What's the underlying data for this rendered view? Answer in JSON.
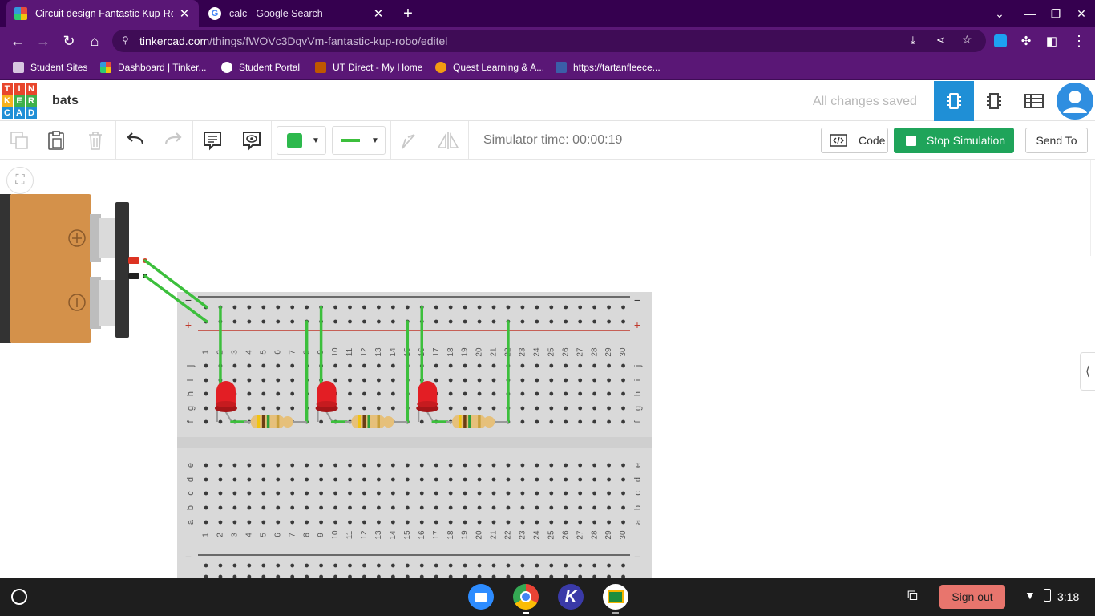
{
  "browser": {
    "tabs": [
      {
        "title": "Circuit design Fantastic Kup-Robo",
        "active": true
      },
      {
        "title": "calc - Google Search",
        "active": false
      }
    ],
    "url_host": "tinkercad.com",
    "url_path": "/things/fWOVc3DqvVm-fantastic-kup-robo/editel",
    "bookmarks": [
      "Student Sites",
      "Dashboard | Tinker...",
      "Student Portal",
      "UT Direct - My Home",
      "Quest Learning & A...",
      "https://tartanfleece..."
    ]
  },
  "header": {
    "logo_letters": [
      "T",
      "I",
      "N",
      "K",
      "E",
      "R",
      "C",
      "A",
      "D"
    ],
    "design_name": "bats",
    "save_status": "All changes saved"
  },
  "toolbar": {
    "simulator_time": "Simulator time: 00:00:19",
    "code_label": "Code",
    "stop_label": "Stop Simulation",
    "send_to_label": "Send To",
    "shape_color": "#2db94d"
  },
  "breadboard": {
    "column_numbers": [
      "1",
      "2",
      "3",
      "4",
      "5",
      "6",
      "7",
      "8",
      "9",
      "10",
      "11",
      "12",
      "13",
      "14",
      "15",
      "16",
      "17",
      "18",
      "19",
      "20",
      "21",
      "22",
      "23",
      "24",
      "25",
      "26",
      "27",
      "28",
      "29",
      "30"
    ],
    "top_rows": [
      "j",
      "i",
      "h",
      "g",
      "f"
    ],
    "bottom_rows": [
      "e",
      "d",
      "c",
      "b",
      "a"
    ],
    "plus_label": "+",
    "minus_label": "−"
  },
  "battery": {
    "plus_label": "+",
    "minus_label": "−"
  },
  "taskbar": {
    "signout_label": "Sign out",
    "clock": "3:18"
  },
  "colors": {
    "chrome_dark": "#35004f",
    "chrome_mid": "#5a1776",
    "accent_blue": "#1f8fd6",
    "stop_green": "#1fa45a",
    "wire_green": "#3cbf3c",
    "led_red": "#e31e24"
  }
}
